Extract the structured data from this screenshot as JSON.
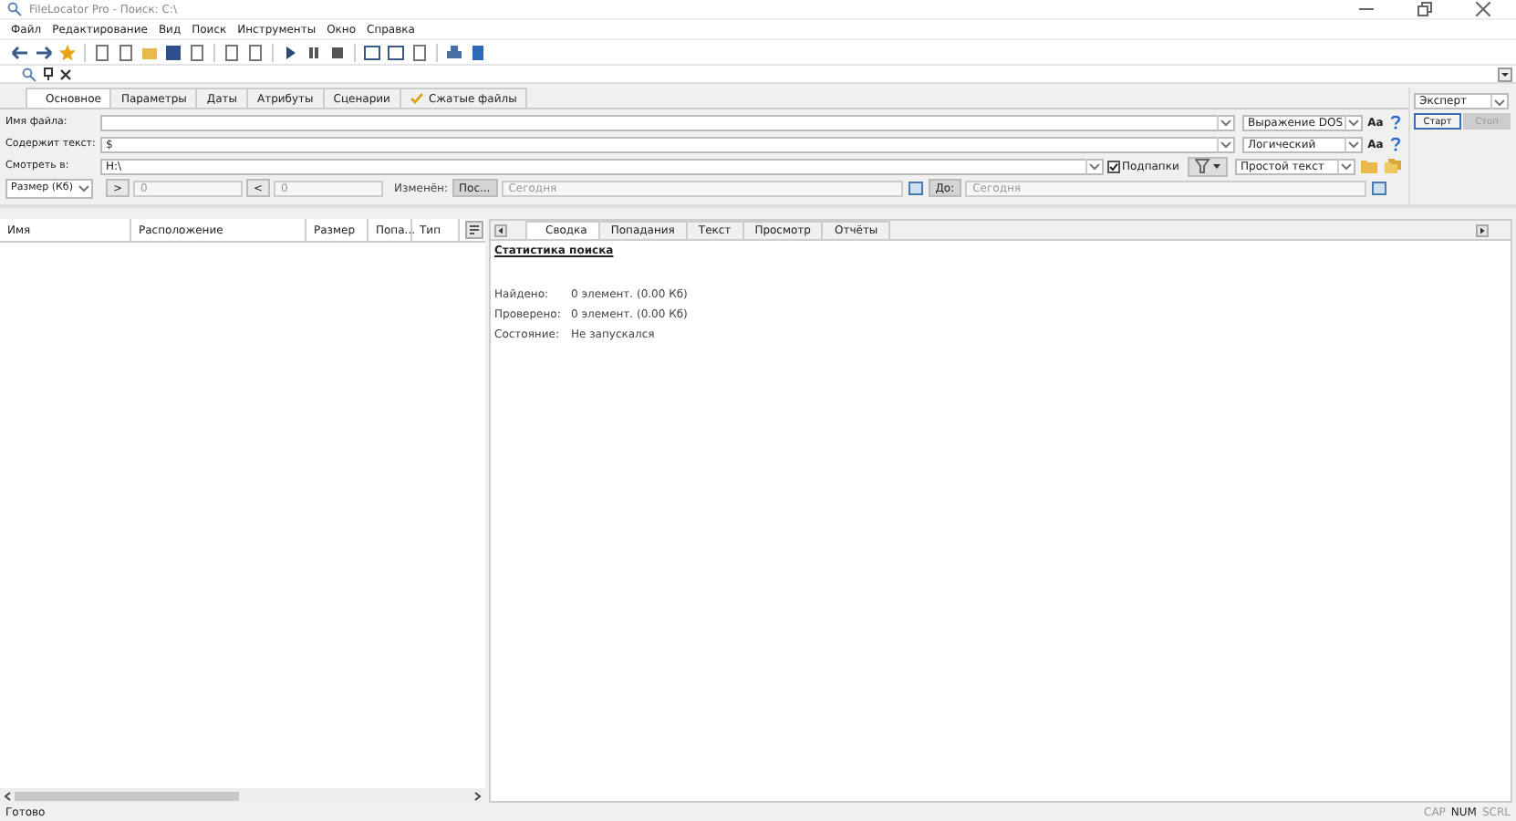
{
  "window": {
    "title": "FileLocator Pro - Поиск: C:\\"
  },
  "menu": [
    "Файл",
    "Редактирование",
    "Вид",
    "Поиск",
    "Инструменты",
    "Окно",
    "Справка"
  ],
  "search_tabs": [
    {
      "label": "Основное",
      "selected": true,
      "checked": false
    },
    {
      "label": "Параметры",
      "selected": false,
      "checked": false
    },
    {
      "label": "Даты",
      "selected": false,
      "checked": false
    },
    {
      "label": "Атрибуты",
      "selected": false,
      "checked": false
    },
    {
      "label": "Сценарии",
      "selected": false,
      "checked": false
    },
    {
      "label": "Сжатые файлы",
      "selected": false,
      "checked": true
    }
  ],
  "fields": [
    {
      "label": "Имя файла:",
      "mode": "Выражение DOS",
      "case_button": "Aa"
    },
    {
      "label": "Содержит текст:",
      "value": "$",
      "mode": "Логический",
      "case_button": "Aa"
    },
    {
      "label": "Смотреть в:",
      "value": "H:\\",
      "mode": "Простой текст",
      "subfolders": {
        "label": "Подпапки",
        "checked": true
      }
    }
  ],
  "size_row": {
    "unit": "Размер (Кб)",
    "gt_op": ">",
    "gt_value": "0",
    "lt_op": "<",
    "lt_value": "0",
    "modified_label": "Изменён:",
    "from_button": "Пос...",
    "from_date": "Сегодня",
    "to_button": "До:",
    "to_date": "Сегодня"
  },
  "preset": "Эксперт",
  "start_button": "Старт",
  "stop_button": {
    "label": "Стоп",
    "disabled": true
  },
  "results": {
    "columns": [
      "Имя",
      "Расположение",
      "Размер",
      "Попа...",
      "Тип"
    ]
  },
  "detail_tabs": [
    {
      "label": "Сводка",
      "selected": true
    },
    {
      "label": "Попадания",
      "selected": false
    },
    {
      "label": "Текст",
      "selected": false
    },
    {
      "label": "Просмотр",
      "selected": false
    },
    {
      "label": "Отчёты",
      "selected": false
    }
  ],
  "summary": {
    "title": "Статистика поиска",
    "rows": [
      {
        "label": "Найдено:",
        "value": "0 элемент. (0.00 Кб)"
      },
      {
        "label": "Проверено:",
        "value": "0 элемент. (0.00 Кб)"
      },
      {
        "label": "Состояние:",
        "value": "Не запускался"
      }
    ]
  },
  "status_bar": {
    "text": "Готово",
    "indicators": [
      {
        "label": "CAP",
        "on": false
      },
      {
        "label": "NUM",
        "on": true
      },
      {
        "label": "SCRL",
        "on": false
      }
    ]
  }
}
